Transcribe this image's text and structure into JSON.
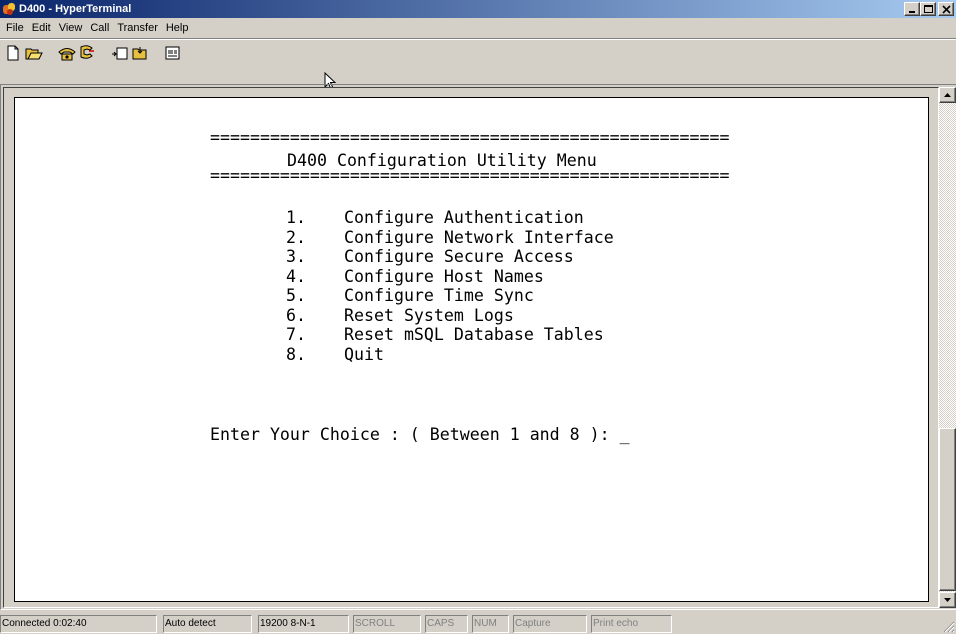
{
  "window": {
    "title": "D400 - HyperTerminal"
  },
  "menu": [
    "File",
    "Edit",
    "View",
    "Call",
    "Transfer",
    "Help"
  ],
  "toolbar": {
    "buttons": [
      "new-connection",
      "open",
      "call",
      "disconnect",
      "send",
      "receive",
      "properties"
    ]
  },
  "terminal": {
    "separator_top": "====================================================",
    "heading": "D400 Configuration Utility Menu",
    "separator_bottom": "====================================================",
    "options": [
      {
        "num": "1.",
        "label": "Configure Authentication"
      },
      {
        "num": "2.",
        "label": "Configure Network Interface"
      },
      {
        "num": "3.",
        "label": "Configure Secure Access"
      },
      {
        "num": "4.",
        "label": "Configure Host Names"
      },
      {
        "num": "5.",
        "label": "Configure Time Sync"
      },
      {
        "num": "6.",
        "label": "Reset System Logs"
      },
      {
        "num": "7.",
        "label": "Reset mSQL Database Tables"
      },
      {
        "num": "8.",
        "label": "Quit"
      }
    ],
    "prompt": "Enter Your Choice : ( Between 1 and 8 ): _"
  },
  "statusbar": {
    "connected": "Connected 0:02:40",
    "detect": "Auto detect",
    "settings": "19200 8-N-1",
    "scroll": "SCROLL",
    "caps": "CAPS",
    "num": "NUM",
    "capture": "Capture",
    "print_echo": "Print echo"
  }
}
